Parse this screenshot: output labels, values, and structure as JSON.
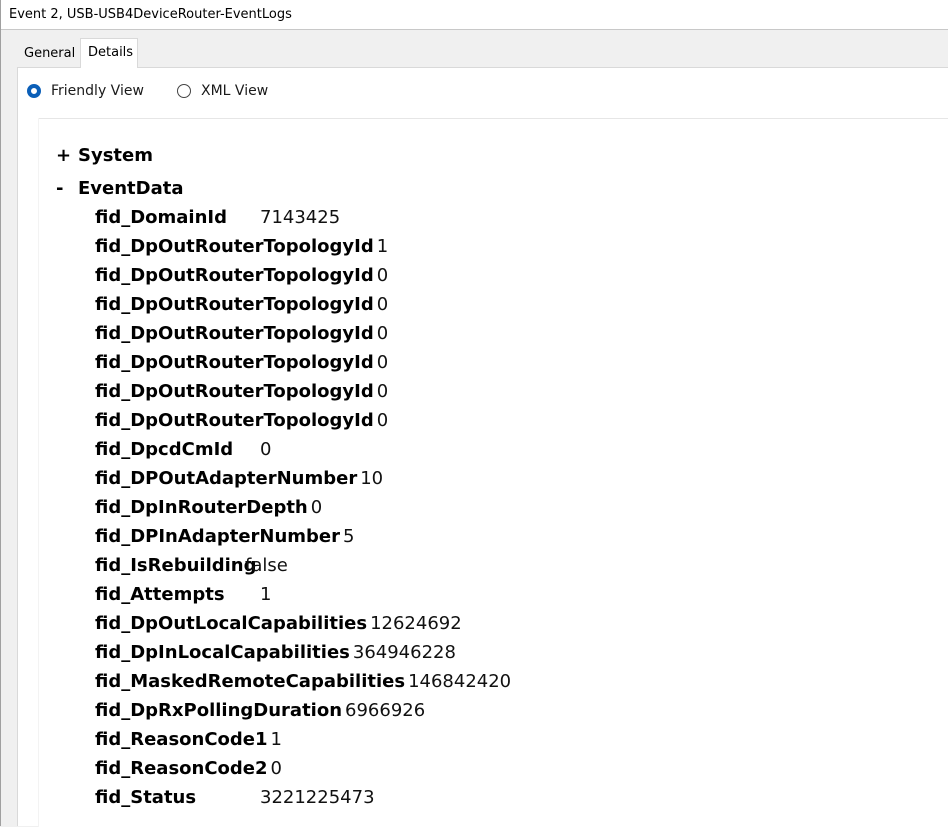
{
  "window": {
    "title": "Event 2, USB-USB4DeviceRouter-EventLogs"
  },
  "tabs": [
    {
      "label": "General",
      "active": false
    },
    {
      "label": "Details",
      "active": true
    }
  ],
  "view_mode": {
    "friendly_label": "Friendly View",
    "xml_label": "XML View",
    "selected": "Friendly View"
  },
  "tree": {
    "system": {
      "sign": "+",
      "label": "System"
    },
    "eventdata": {
      "sign": "-",
      "label": "EventData"
    }
  },
  "event_data": [
    {
      "key": "fid_DomainId",
      "value": "7143425"
    },
    {
      "key": "fid_DpOutRouterTopologyId",
      "value": "1"
    },
    {
      "key": "fid_DpOutRouterTopologyId",
      "value": "0"
    },
    {
      "key": "fid_DpOutRouterTopologyId",
      "value": "0"
    },
    {
      "key": "fid_DpOutRouterTopologyId",
      "value": "0"
    },
    {
      "key": "fid_DpOutRouterTopologyId",
      "value": "0"
    },
    {
      "key": "fid_DpOutRouterTopologyId",
      "value": "0"
    },
    {
      "key": "fid_DpOutRouterTopologyId",
      "value": "0"
    },
    {
      "key": "fid_DpcdCmId",
      "value": "0"
    },
    {
      "key": "fid_DPOutAdapterNumber",
      "value": "10"
    },
    {
      "key": "fid_DpInRouterDepth",
      "value": "0"
    },
    {
      "key": "fid_DPInAdapterNumber",
      "value": "5"
    },
    {
      "key": "fid_IsRebuilding",
      "value": "false"
    },
    {
      "key": "fid_Attempts",
      "value": "1"
    },
    {
      "key": "fid_DpOutLocalCapabilities",
      "value": "12624692"
    },
    {
      "key": "fid_DpInLocalCapabilities",
      "value": "364946228"
    },
    {
      "key": "fid_MaskedRemoteCapabilities",
      "value": "146842420"
    },
    {
      "key": "fid_DpRxPollingDuration",
      "value": "6966926"
    },
    {
      "key": "fid_ReasonCode1",
      "value": "1"
    },
    {
      "key": "fid_ReasonCode2",
      "value": "0"
    },
    {
      "key": "fid_Status",
      "value": "3221225473"
    }
  ]
}
